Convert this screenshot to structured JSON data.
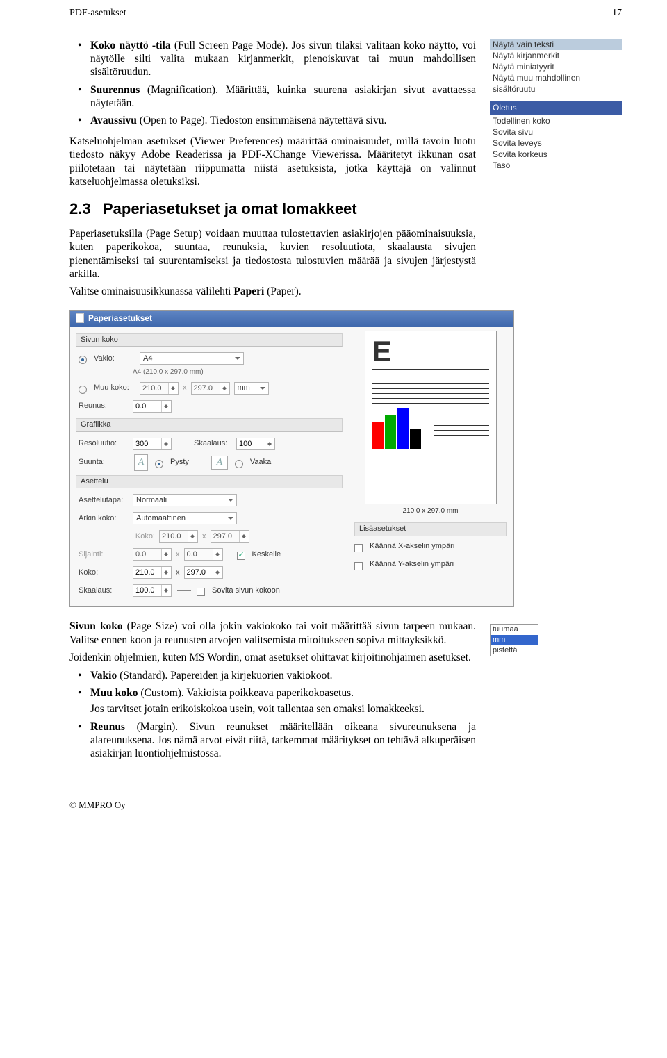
{
  "header": {
    "title": "PDF-asetukset",
    "page": "17"
  },
  "bullets_top": [
    {
      "b": "Koko näyttö -tila",
      "rest": " (Full Screen Page Mode). Jos sivun tilaksi valitaan koko näyttö, voi näytölle silti valita mukaan kirjanmerkit, pienoiskuvat tai muun mahdollisen sisältöruudun."
    },
    {
      "b": "Suurennus",
      "rest": " (Magnification). Määrittää, kuinka suurena asiakirjan sivut avattaessa näytetään."
    },
    {
      "b": "Avaussivu",
      "rest": " (Open to Page). Tiedoston ensimmäisenä näytettävä sivu."
    }
  ],
  "para1": "Katseluohjelman asetukset (Viewer Preferences) määrittää ominaisuudet, millä tavoin luotu tiedosto näkyy Adobe Readerissa ja PDF-XChange Viewerissa. Määritetyt ikkunan osat piilotetaan tai näytetään riippumatta niistä asetuksista, jotka käyttäjä on valinnut katseluohjelmassa oletuksiksi.",
  "section": {
    "num": "2.3",
    "title": "Paperiasetukset ja omat lomakkeet"
  },
  "para2": "Paperiasetuksilla (Page Setup) voidaan muuttaa tulostettavien asiakirjojen pääominaisuuksia, kuten paperikokoa, suuntaa, reunuksia, kuvien resoluutiota, skaalausta sivujen pienentämiseksi tai suurentamiseksi ja tiedostosta tulostuvien määrää ja sivujen järjestystä arkilla.",
  "para3": "Valitse ominaisuusikkunassa välilehti ",
  "para3b": "Paperi",
  "para3c": " (Paper).",
  "para4a": "Sivun koko",
  "para4b": " (Page Size) voi olla jokin vakiokoko tai voit määrittää sivun tarpeen mukaan. Valitse ennen koon ja reunusten arvojen valitsemista mitoitukseen sopiva mittayksikkö.",
  "para5": "Joidenkin ohjelmien, kuten MS Wordin, omat asetukset ohittavat kirjoitinohjaimen asetukset.",
  "bullets_bottom": [
    {
      "b": "Vakio",
      "rest": " (Standard). Papereiden ja kirjekuorien vakiokoot."
    },
    {
      "b": "Muu koko",
      "rest": " (Custom). Vakioista poikkeava paperikokoasetus.",
      "sub": "Jos tarvitset jotain erikoiskokoa usein, voit tallentaa sen omaksi lomakkeeksi."
    },
    {
      "b": "Reunus",
      "rest": " (Margin). Sivun reunukset määritellään oikeana sivureunuksena ja alareunuksena. Jos nämä arvot eivät riitä, tarkemmat määritykset on tehtävä alkuperäisen asiakirjan luontiohjelmistossa."
    }
  ],
  "side1": {
    "items": [
      "Näytä vain teksti",
      "Näytä kirjanmerkit",
      "Näytä miniatyyrit",
      "Näytä muu mahdollinen sisältöruutu"
    ]
  },
  "side2": {
    "title": "Oletus",
    "items": [
      "Todellinen koko",
      "Sovita sivu",
      "Sovita leveys",
      "Sovita korkeus",
      "Taso"
    ]
  },
  "units": {
    "items": [
      "tuumaa",
      "mm",
      "pistettä"
    ],
    "selected": "mm"
  },
  "shot": {
    "title": "Paperiasetukset",
    "grp_size": "Sivun koko",
    "lbl_vakio": "Vakio:",
    "dd_vakio": "A4",
    "note_vakio": "A4 (210.0 x 297.0 mm)",
    "lbl_muu": "Muu koko:",
    "muu_w": "210.0",
    "muu_h": "297.0",
    "dd_unit": "mm",
    "lbl_reunus": "Reunus:",
    "reunus": "0.0",
    "grp_gfx": "Grafiikka",
    "lbl_res": "Resoluutio:",
    "res": "300",
    "lbl_skaal": "Skaalaus:",
    "skaal": "100",
    "lbl_suunta": "Suunta:",
    "ori_p": "Pysty",
    "ori_l": "Vaaka",
    "grp_layout": "Asettelu",
    "lbl_tapa": "Asettelutapa:",
    "dd_tapa": "Normaali",
    "lbl_arkin": "Arkin koko:",
    "dd_arkin": "Automaattinen",
    "lbl_koko2": "Koko:",
    "koko_w": "210.0",
    "koko_h": "297.0",
    "lbl_sij": "Sijainti:",
    "sij_x": "0.0",
    "sij_y": "0.0",
    "cb_keskelle": "Keskelle",
    "lbl_koko3": "Koko:",
    "k3_w": "210.0",
    "k3_h": "297.0",
    "lbl_skaal2": "Skaalaus:",
    "skaal2": "100.0",
    "cb_sovita": "Sovita sivun kokoon",
    "pv_caption": "210.0 x 297.0 mm",
    "grp_lisa": "Lisäasetukset",
    "cb_flipx": "Käännä X-akselin ympäri",
    "cb_flipy": "Käännä Y-akselin ympäri"
  },
  "footer": "© MMPRO Oy"
}
